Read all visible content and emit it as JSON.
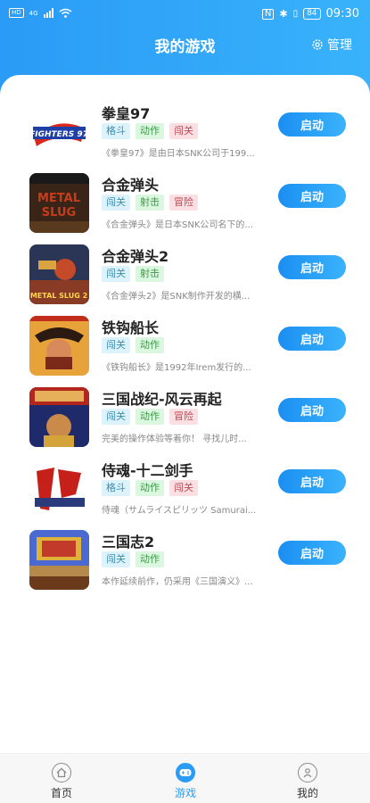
{
  "status": {
    "time": "09:30",
    "battery": "84",
    "network": "HD",
    "signal_gen": "4G"
  },
  "header": {
    "title": "我的游戏",
    "manage_label": "管理"
  },
  "games": [
    {
      "name": "拳皇97",
      "tags": [
        "格斗",
        "动作",
        "闯关"
      ],
      "desc": "《拳皇97》是由日本SNK公司于199...",
      "button": "启动"
    },
    {
      "name": "合金弹头",
      "tags": [
        "闯关",
        "射击",
        "冒险"
      ],
      "desc": "《合金弹头》是日本SNK公司名下的...",
      "button": "启动"
    },
    {
      "name": "合金弹头2",
      "tags": [
        "闯关",
        "射击"
      ],
      "desc": "《合金弹头2》是SNK制作开发的横...",
      "button": "启动"
    },
    {
      "name": "铁钩船长",
      "tags": [
        "闯关",
        "动作"
      ],
      "desc": "《铁钩船长》是1992年Irem发行的...",
      "button": "启动"
    },
    {
      "name": "三国战纪-风云再起",
      "tags": [
        "闯关",
        "动作",
        "冒险"
      ],
      "desc": "完美的操作体验等着你！ 寻找儿时...",
      "button": "启动"
    },
    {
      "name": "侍魂-十二剑手",
      "tags": [
        "格斗",
        "动作",
        "闯关"
      ],
      "desc": "侍魂（サムライスピリッツ Samurai...",
      "button": "启动"
    },
    {
      "name": "三国志2",
      "tags": [
        "闯关",
        "动作"
      ],
      "desc": "本作延续前作，仍采用《三国演义》...",
      "button": "启动"
    }
  ],
  "tabbar": {
    "home": "首页",
    "games": "游戏",
    "mine": "我的"
  },
  "colors": {
    "accent": "#2a9bf6",
    "tag_blue_bg": "#ddf3fb",
    "tag_green_bg": "#dcf7df",
    "tag_pink_bg": "#fbe0e3"
  }
}
